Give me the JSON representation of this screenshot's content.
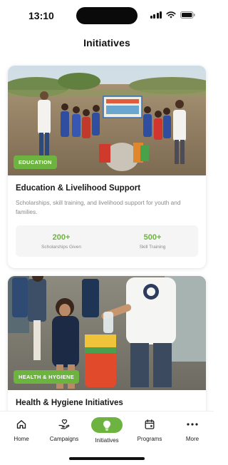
{
  "status_bar": {
    "time": "13:10"
  },
  "header": {
    "title": "Initiatives"
  },
  "colors": {
    "accent": "#6db33f",
    "muted_text": "#8a8a8a"
  },
  "initiatives": [
    {
      "badge": "EDUCATION",
      "title": "Education & Livelihood Support",
      "description": "Scholarships, skill training, and livelihood support for youth and families.",
      "stats": [
        {
          "value": "200+",
          "label": "Scholarships Given"
        },
        {
          "value": "500+",
          "label": "Skill Training"
        }
      ]
    },
    {
      "badge": "HEALTH & HYGIENE",
      "title": "Health & Hygiene Initiatives"
    }
  ],
  "tab_bar": {
    "active": "Initiatives",
    "tabs": [
      {
        "label": "Home",
        "icon": "home-icon"
      },
      {
        "label": "Campaigns",
        "icon": "hand-heart-icon"
      },
      {
        "label": "Initiatives",
        "icon": "lightbulb-icon"
      },
      {
        "label": "Programs",
        "icon": "calendar-icon"
      },
      {
        "label": "More",
        "icon": "more-dots-icon"
      }
    ]
  }
}
